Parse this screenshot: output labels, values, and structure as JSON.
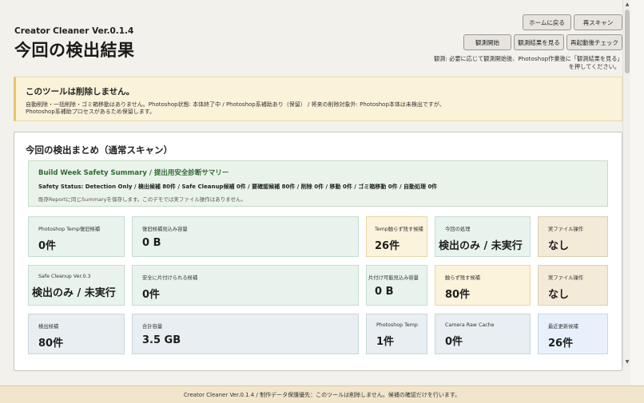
{
  "header": {
    "app_name": "Creator Cleaner Ver.0.1.4",
    "title": "今回の検出結果",
    "buttons": {
      "home": "ホームに戻る",
      "rescan": "再スキャン",
      "observe_start": "観測開始",
      "observe_result": "観測結果を見る",
      "restart_check": "再起動後チェック"
    },
    "note": "観測: 必要に応じて観測開始後、Photoshop作業後に「観測結果を見る」を押してください。"
  },
  "warning": {
    "title": "このツールは削除しません。",
    "body": "自動削除・一括削除・ゴミ箱移動はありません。Photoshop状態: 本体終了中 / Photoshop系補助あり（保留） / 将来の削除対象外: Photoshop本体は未検出ですが、Photoshop系補助プロセスがあるため保留します。"
  },
  "panel": {
    "title": "今回の検出まとめ（通常スキャン）",
    "summary": {
      "title": "Build Week Safety Summary / 提出用安全診断サマリー",
      "status": "Safety Status: Detection Only / 検出候補 80件 / Safe Cleanup候補 0件 / 要確認候補 80件 / 削除 0件 / 移動 0件 / ゴミ箱移動 0件 / 自動処理 0件",
      "note": "既存Reportに同じSummaryを保存します。このデモでは実ファイル操作はありません。"
    },
    "cards": [
      {
        "label": "Photoshop Temp復旧候補",
        "value": "0件"
      },
      {
        "label": "復旧候補見込み容量",
        "value": "0 B"
      },
      {
        "label": "Temp触らず残す候補",
        "value": "26件"
      },
      {
        "label": "今回の処理",
        "value": "検出のみ / 未実行"
      },
      {
        "label": "実ファイル操作",
        "value": "なし"
      },
      {
        "label": "Safe Cleanup Ver.0.3",
        "value": "検出のみ / 未実行"
      },
      {
        "label": "安全に片付けられる候補",
        "value": "0件"
      },
      {
        "label": "片付け可能見込み容量",
        "value": "0 B"
      },
      {
        "label": "触らず残す候補",
        "value": "80件"
      },
      {
        "label": "実ファイル操作",
        "value": "なし"
      },
      {
        "label": "検出候補",
        "value": "80件"
      },
      {
        "label": "合計容量",
        "value": "3.5 GB"
      },
      {
        "label": "Photoshop Temp",
        "value": "1件"
      },
      {
        "label": "Camera Raw Cache",
        "value": "0件"
      },
      {
        "label": "最近更新候補",
        "value": "26件"
      }
    ]
  },
  "footer": {
    "text": "Creator Cleaner Ver.0.1.4 / 制作データ保護優先：このツールは削除しません。候補の確認だけを行います。"
  }
}
